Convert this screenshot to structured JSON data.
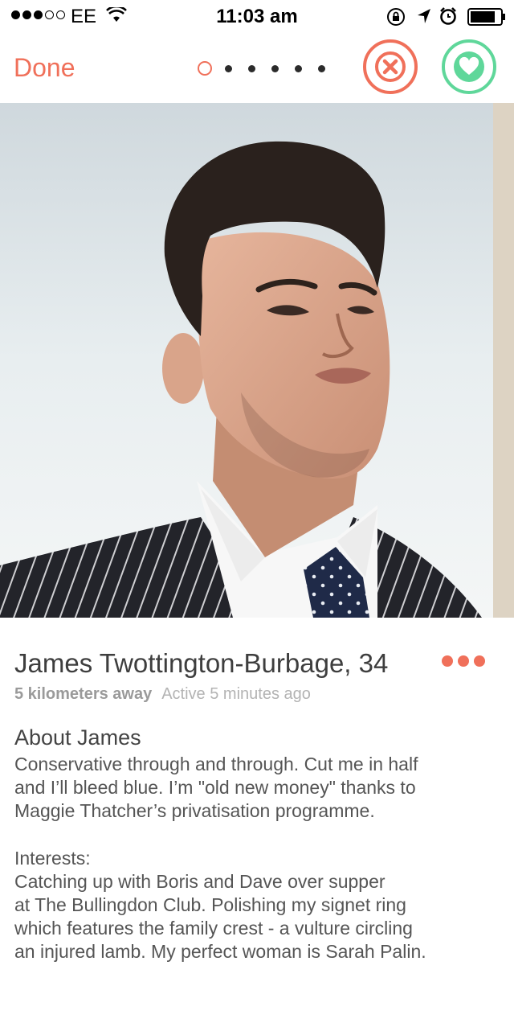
{
  "status_bar": {
    "carrier": "EE",
    "time": "11:03 am",
    "signal_bars": 3,
    "signal_total": 5,
    "icons": [
      "wifi-icon",
      "rotation-lock-icon",
      "location-arrow-icon",
      "alarm-icon",
      "battery-icon"
    ]
  },
  "nav": {
    "done_label": "Done",
    "photo_count": 6,
    "current_photo": 1,
    "nope_icon": "close-icon",
    "like_icon": "heart-icon"
  },
  "profile": {
    "name_age": "James Twottington-Burbage, 34",
    "distance": "5 kilometers away",
    "active": "Active 5 minutes ago",
    "about_title": "About James",
    "about_text": "Conservative through and through. Cut me in half\nand I’ll bleed blue. I’m \"old new money\" thanks to\nMaggie Thatcher’s privatisation programme.",
    "interests_label": "Interests:",
    "interests_text": "Catching up with Boris and Dave over supper\nat The Bullingdon Club. Polishing my signet ring\nwhich features the family crest - a vulture circling\nan injured lamb. My perfect woman is Sarah Palin."
  },
  "colors": {
    "accent": "#f0705a",
    "like": "#5fd79a",
    "text": "#3e3e3e",
    "muted": "#9a9a9a"
  }
}
